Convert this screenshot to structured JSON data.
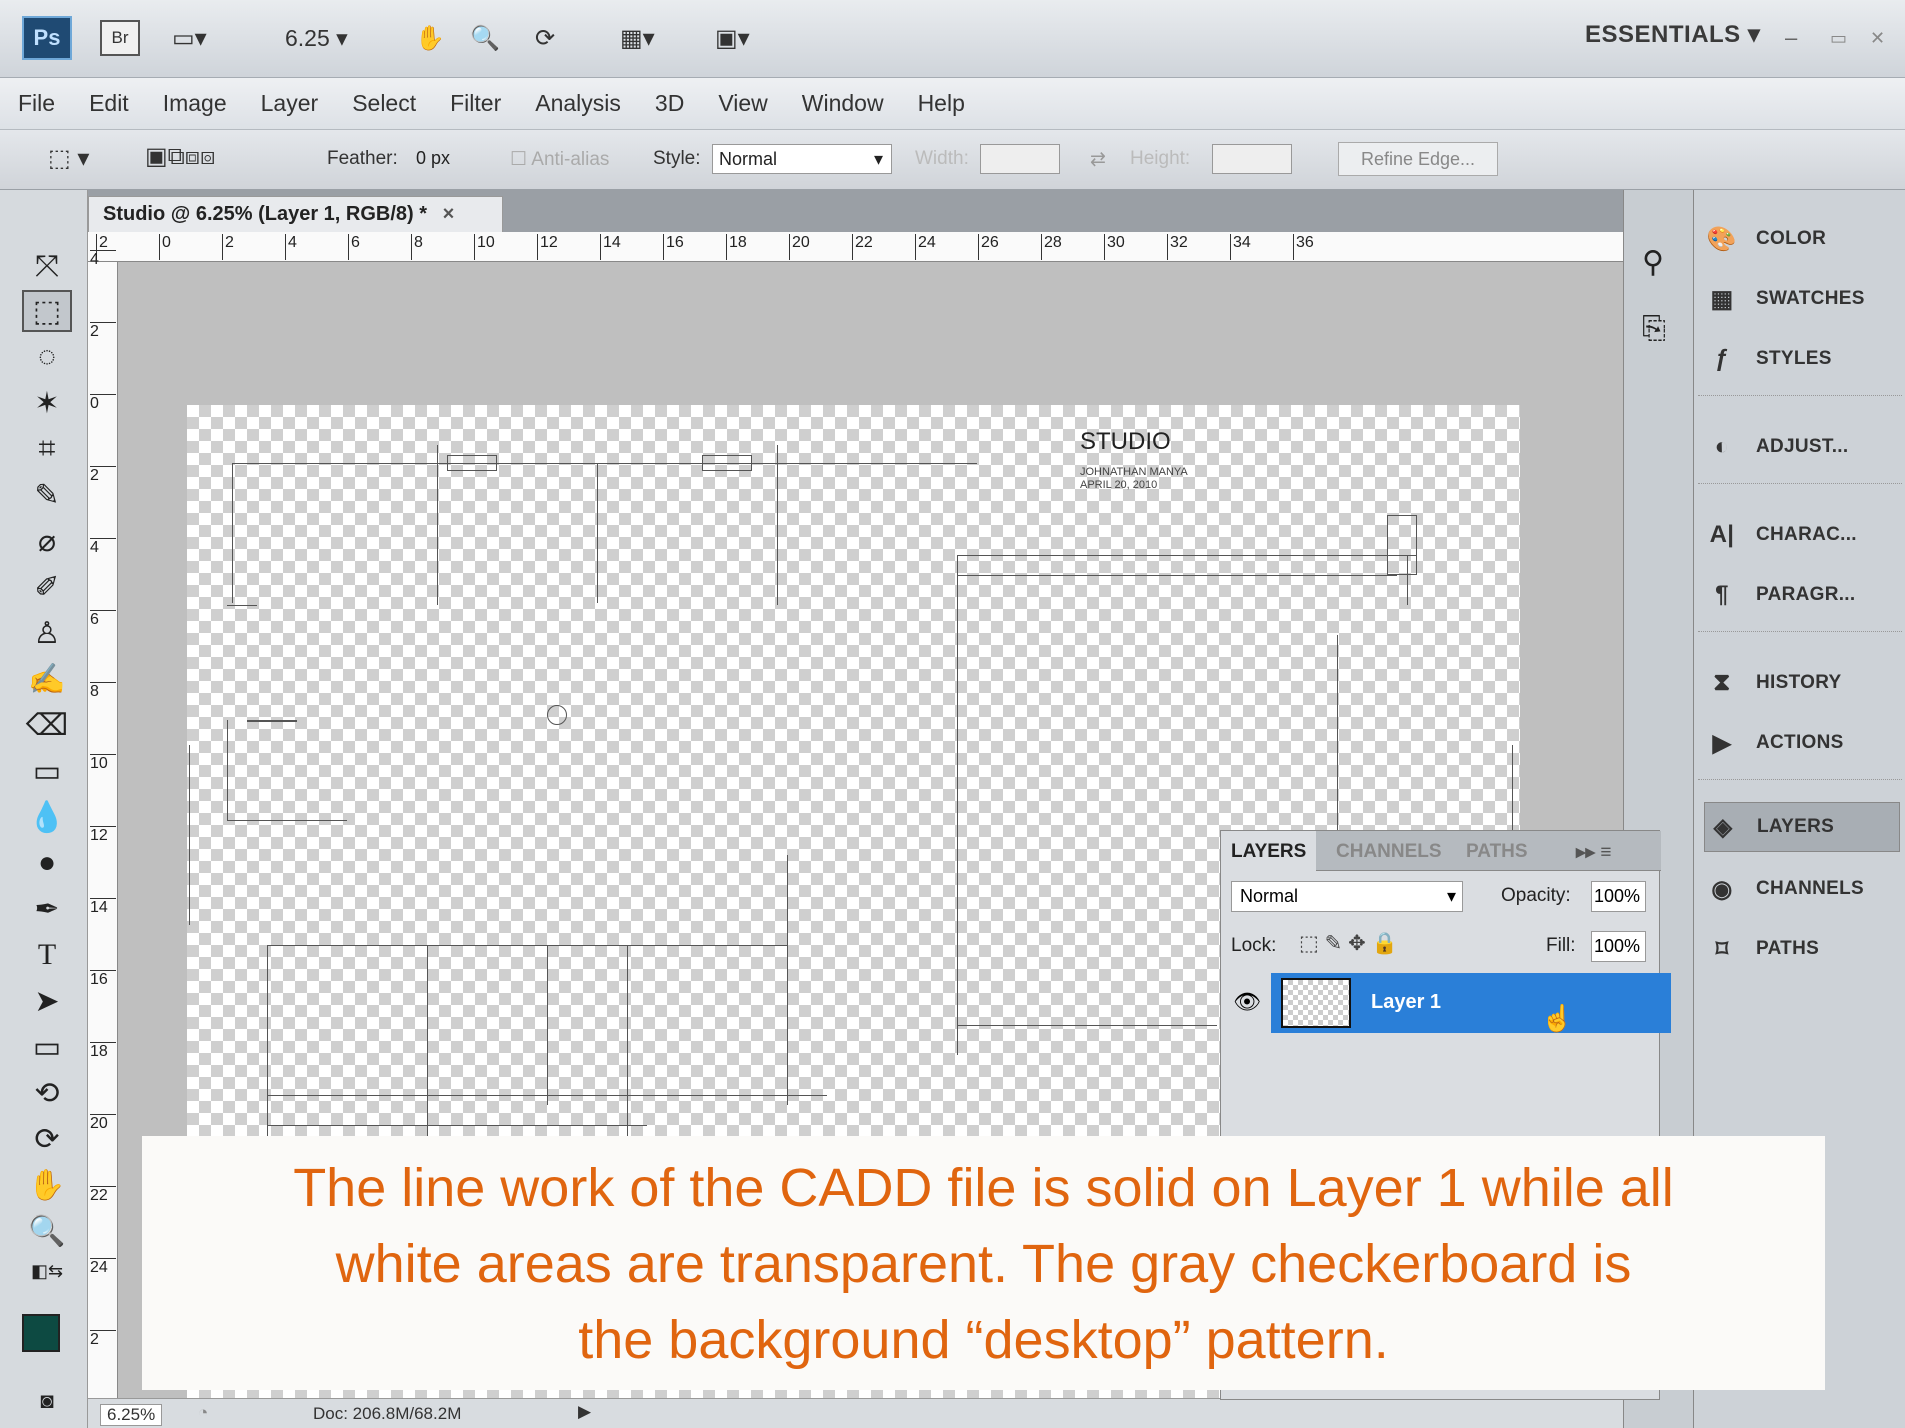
{
  "appbar": {
    "ps_logo": "Ps",
    "br_button": "Br",
    "zoom_value": "6.25",
    "workspace": "ESSENTIALS"
  },
  "menu": [
    "File",
    "Edit",
    "Image",
    "Layer",
    "Select",
    "Filter",
    "Analysis",
    "3D",
    "View",
    "Window",
    "Help"
  ],
  "options": {
    "feather_label": "Feather:",
    "feather_value": "0 px",
    "antialias_label": "Anti-alias",
    "style_label": "Style:",
    "style_value": "Normal",
    "width_label": "Width:",
    "height_label": "Height:",
    "refine_edge": "Refine Edge..."
  },
  "document": {
    "tab_title": "Studio @ 6.25% (Layer 1, RGB/8) *",
    "close": "×",
    "ruler_h": [
      "2",
      "0",
      "2",
      "4",
      "6",
      "8",
      "10",
      "12",
      "14",
      "16",
      "18",
      "20",
      "22",
      "24",
      "26",
      "28",
      "30",
      "32",
      "34",
      "36"
    ],
    "ruler_v": [
      "4",
      "2",
      "0",
      "2",
      "4",
      "6",
      "8",
      "10",
      "12",
      "14",
      "16",
      "18",
      "20",
      "22",
      "24",
      "2"
    ],
    "studio_title": "STUDIO",
    "studio_sub1": "JOHNATHAN MANYA",
    "studio_sub2": "APRIL 20, 2010"
  },
  "status": {
    "zoom": "6.25%",
    "doc": "Doc: 206.8M/68.2M"
  },
  "panels": {
    "color": "COLOR",
    "swatches": "SWATCHES",
    "styles": "STYLES",
    "adjust": "ADJUST...",
    "charac": "CHARAC...",
    "paragr": "PARAGR...",
    "history": "HISTORY",
    "actions": "ACTIONS",
    "layers": "LAYERS",
    "channels": "CHANNELS",
    "paths": "PATHS"
  },
  "layers_panel": {
    "tab_layers": "LAYERS",
    "tab_channels": "CHANNELS",
    "tab_paths": "PATHS",
    "blend_mode": "Normal",
    "opacity_label": "Opacity:",
    "opacity_value": "100%",
    "lock_label": "Lock:",
    "fill_label": "Fill:",
    "fill_value": "100%",
    "layer_name": "Layer 1"
  },
  "caption": {
    "line1": "The line work of the CADD file is solid on Layer 1 while all",
    "line2": "white areas are transparent. The gray checkerboard is",
    "line3": "the background “desktop” pattern."
  },
  "colors": {
    "caption_text": "#e0650f",
    "selected_layer": "#2a7fd8",
    "foreground_swatch": "#0d4a42"
  }
}
